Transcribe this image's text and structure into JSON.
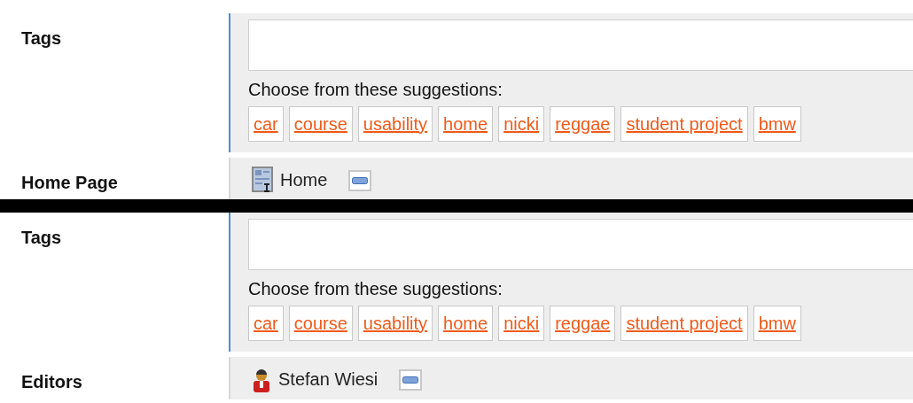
{
  "panels": [
    {
      "rows": [
        {
          "kind": "tags",
          "label": "Tags",
          "hint": "Choose from these suggestions:",
          "suggestions": [
            "car",
            "course",
            "usability",
            "home",
            "nicki",
            "reggae",
            "student project",
            "bmw"
          ]
        },
        {
          "kind": "page",
          "label": "Home Page",
          "value": "Home"
        }
      ]
    },
    {
      "rows": [
        {
          "kind": "tags",
          "label": "Tags",
          "hint": "Choose from these suggestions:",
          "suggestions": [
            "car",
            "course",
            "usability",
            "home",
            "nicki",
            "reggae",
            "student project",
            "bmw"
          ]
        },
        {
          "kind": "user",
          "label": "Editors",
          "value": "Stefan Wiesi"
        }
      ]
    }
  ]
}
